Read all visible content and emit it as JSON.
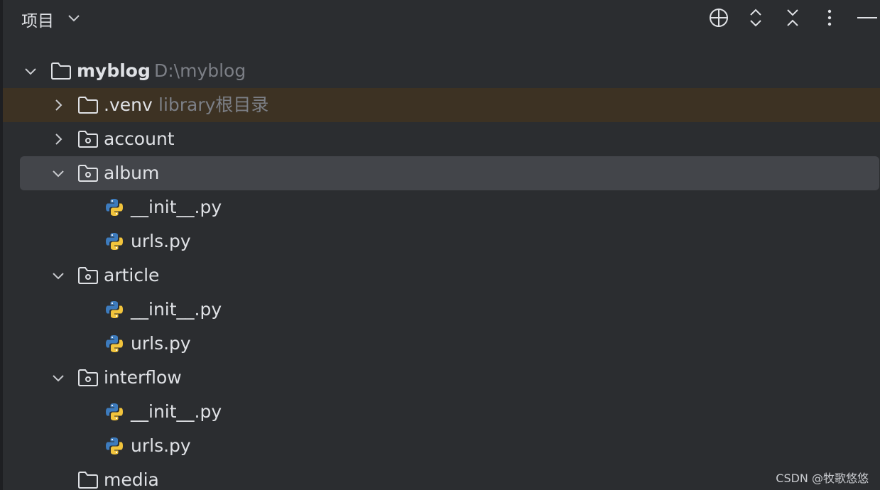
{
  "header": {
    "title": "项目",
    "icons": [
      "chevron-down-icon",
      "locate-icon",
      "expand-all-icon",
      "collapse-all-icon",
      "more-options-icon",
      "minimize-icon"
    ]
  },
  "tree": {
    "root": {
      "name": "myblog",
      "path": "D:\\myblog"
    },
    "venv": {
      "name": ".venv",
      "hint": "library根目录"
    },
    "account": {
      "name": "account"
    },
    "album": {
      "name": "album",
      "files": [
        "__init__.py",
        "urls.py"
      ]
    },
    "article": {
      "name": "article",
      "files": [
        "__init__.py",
        "urls.py"
      ]
    },
    "interflow": {
      "name": "interflow",
      "files": [
        "__init__.py",
        "urls.py"
      ]
    },
    "media": {
      "name": "media"
    }
  },
  "colors": {
    "background": "#2b2d30",
    "selected_row": "#43454a",
    "excluded_row": "#3d3223",
    "text": "#dfe1e5",
    "hint_text": "#7c7f86"
  },
  "watermark": "CSDN @牧歌悠悠"
}
